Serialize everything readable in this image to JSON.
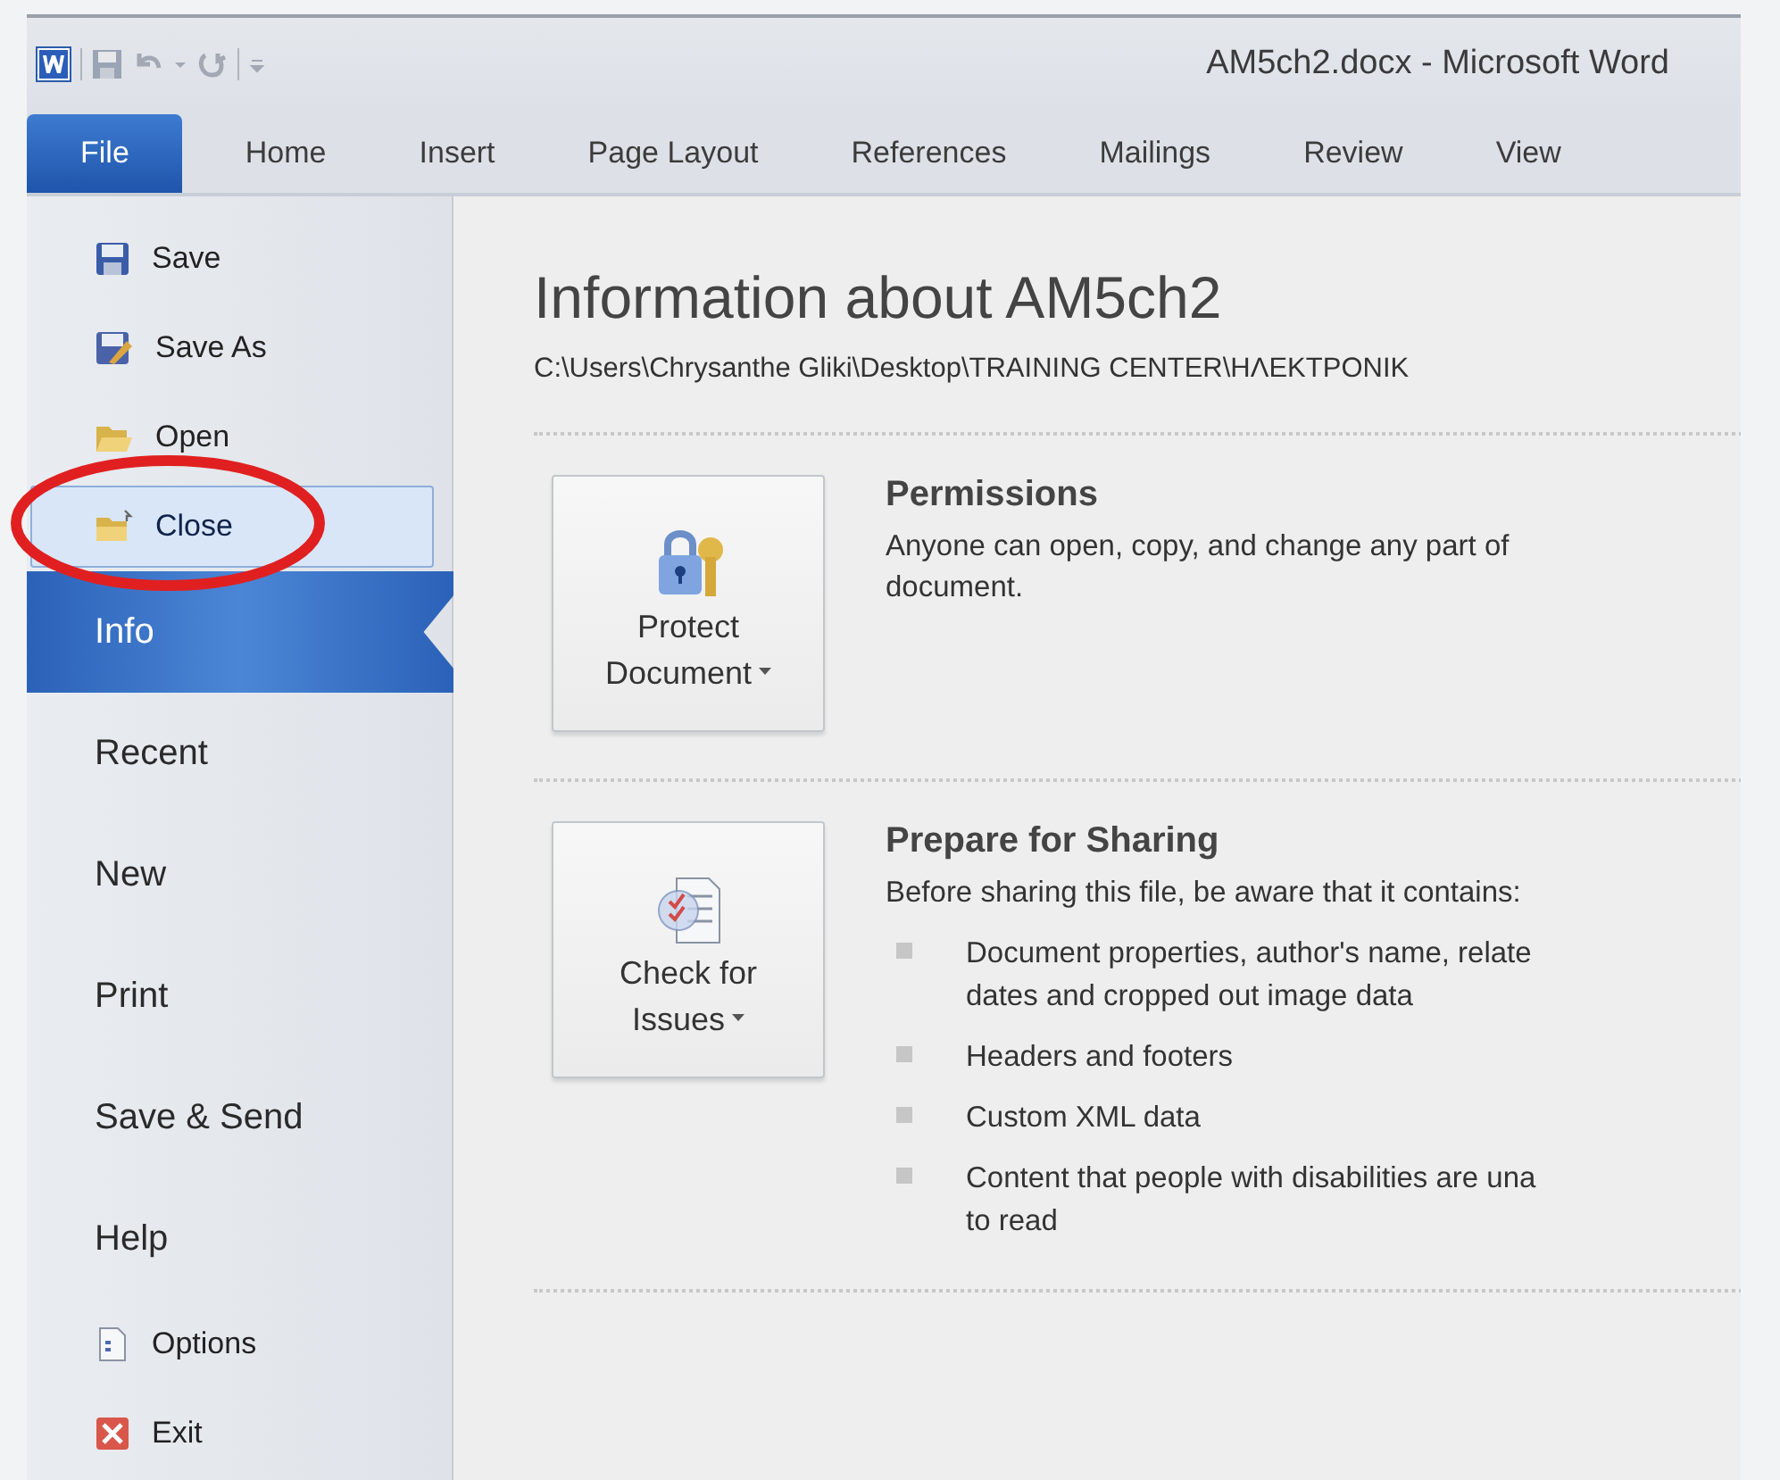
{
  "window": {
    "title": "AM5ch2.docx - Microsoft Word"
  },
  "tabs": [
    {
      "label": "File",
      "selected": true
    },
    {
      "label": "Home",
      "selected": false
    },
    {
      "label": "Insert",
      "selected": false
    },
    {
      "label": "Page Layout",
      "selected": false
    },
    {
      "label": "References",
      "selected": false
    },
    {
      "label": "Mailings",
      "selected": false
    },
    {
      "label": "Review",
      "selected": false
    },
    {
      "label": "View",
      "selected": false
    }
  ],
  "sidebar": {
    "commands": [
      {
        "label": "Save",
        "kind": "save",
        "highlighted": false
      },
      {
        "label": "Save As",
        "kind": "save_as",
        "highlighted": false
      },
      {
        "label": "Open",
        "kind": "open",
        "highlighted": false
      },
      {
        "label": "Close",
        "kind": "close",
        "highlighted": true
      }
    ],
    "items": [
      {
        "label": "Info",
        "selected": true
      },
      {
        "label": "Recent",
        "selected": false
      },
      {
        "label": "New",
        "selected": false
      },
      {
        "label": "Print",
        "selected": false
      },
      {
        "label": "Save & Send",
        "selected": false
      },
      {
        "label": "Help",
        "selected": false
      }
    ],
    "footer": [
      {
        "label": "Options",
        "kind": "options",
        "highlighted": false
      },
      {
        "label": "Exit",
        "kind": "exit",
        "highlighted": false
      }
    ]
  },
  "content": {
    "title": "Information about AM5ch2",
    "path": "C:\\Users\\Chrysanthe Gliki\\Desktop\\TRAINING CENTER\\ΗΛΕΚΤΡΟΝΙΚ",
    "sections": [
      {
        "kind": "protect",
        "button": [
          "Protect",
          "Document"
        ],
        "heading": "Permissions",
        "description": "Anyone can open, copy, and change any part of",
        "description_cont": "document."
      },
      {
        "kind": "check",
        "button": [
          "Check for",
          "Issues"
        ],
        "heading": "Prepare for Sharing",
        "description": "Before sharing this file, be aware that it contains:",
        "bullets": [
          [
            "Document properties, author's name, relate",
            "dates and cropped out image data"
          ],
          [
            "Headers and footers"
          ],
          [
            "Custom XML data"
          ],
          [
            "Content that people with disabilities are una",
            "to read"
          ]
        ]
      }
    ]
  }
}
